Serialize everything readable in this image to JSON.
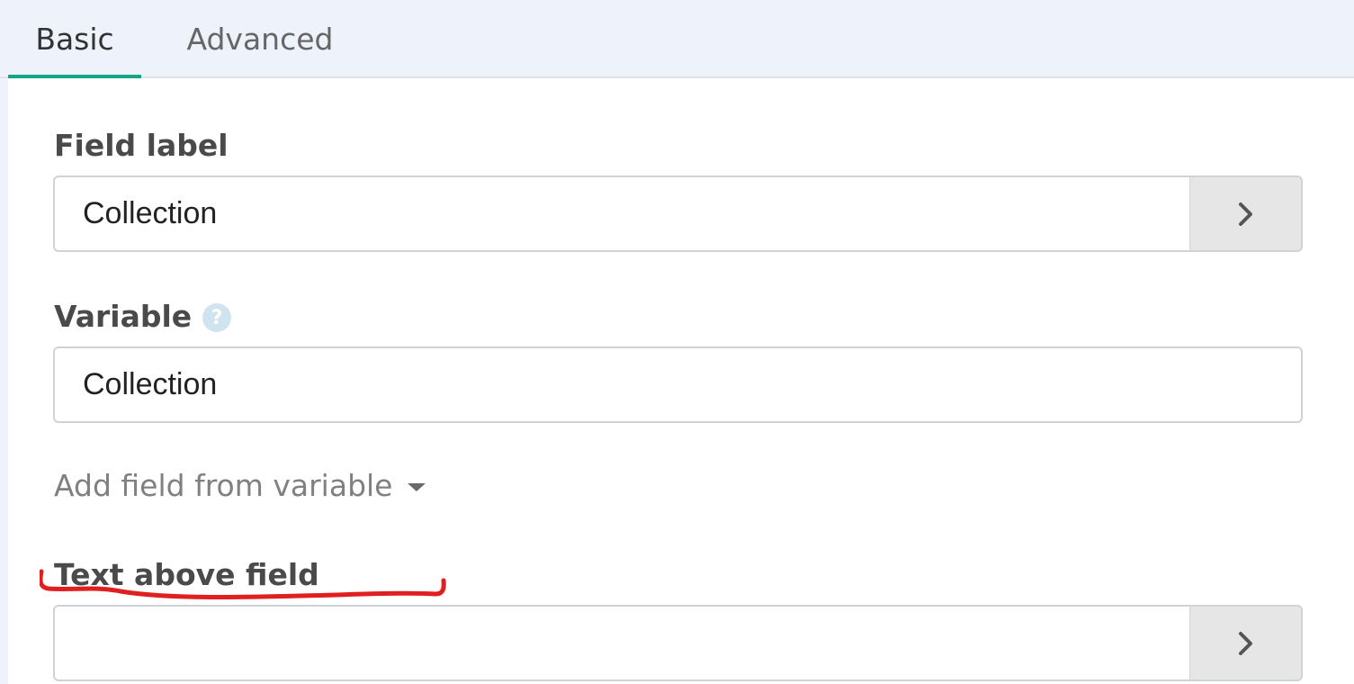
{
  "tabs": [
    {
      "label": "Basic",
      "active": true
    },
    {
      "label": "Advanced",
      "active": false
    }
  ],
  "form": {
    "field_label": {
      "label": "Field label",
      "value": "Collection"
    },
    "variable": {
      "label": "Variable",
      "value": "Collection",
      "help_glyph": "?"
    },
    "add_field_link": "Add field from variable",
    "text_above_field": {
      "label": "Text above field",
      "value": ""
    }
  },
  "icons": {
    "addon": "chevron-right-icon",
    "help": "question-circle-icon",
    "dropdown": "caret-down-icon"
  },
  "colors": {
    "active_tab_underline": "#16a589",
    "annotation_stroke": "#e02020",
    "help_icon_bg": "#cfe4ef",
    "addon_bg": "#e6e6e6"
  }
}
